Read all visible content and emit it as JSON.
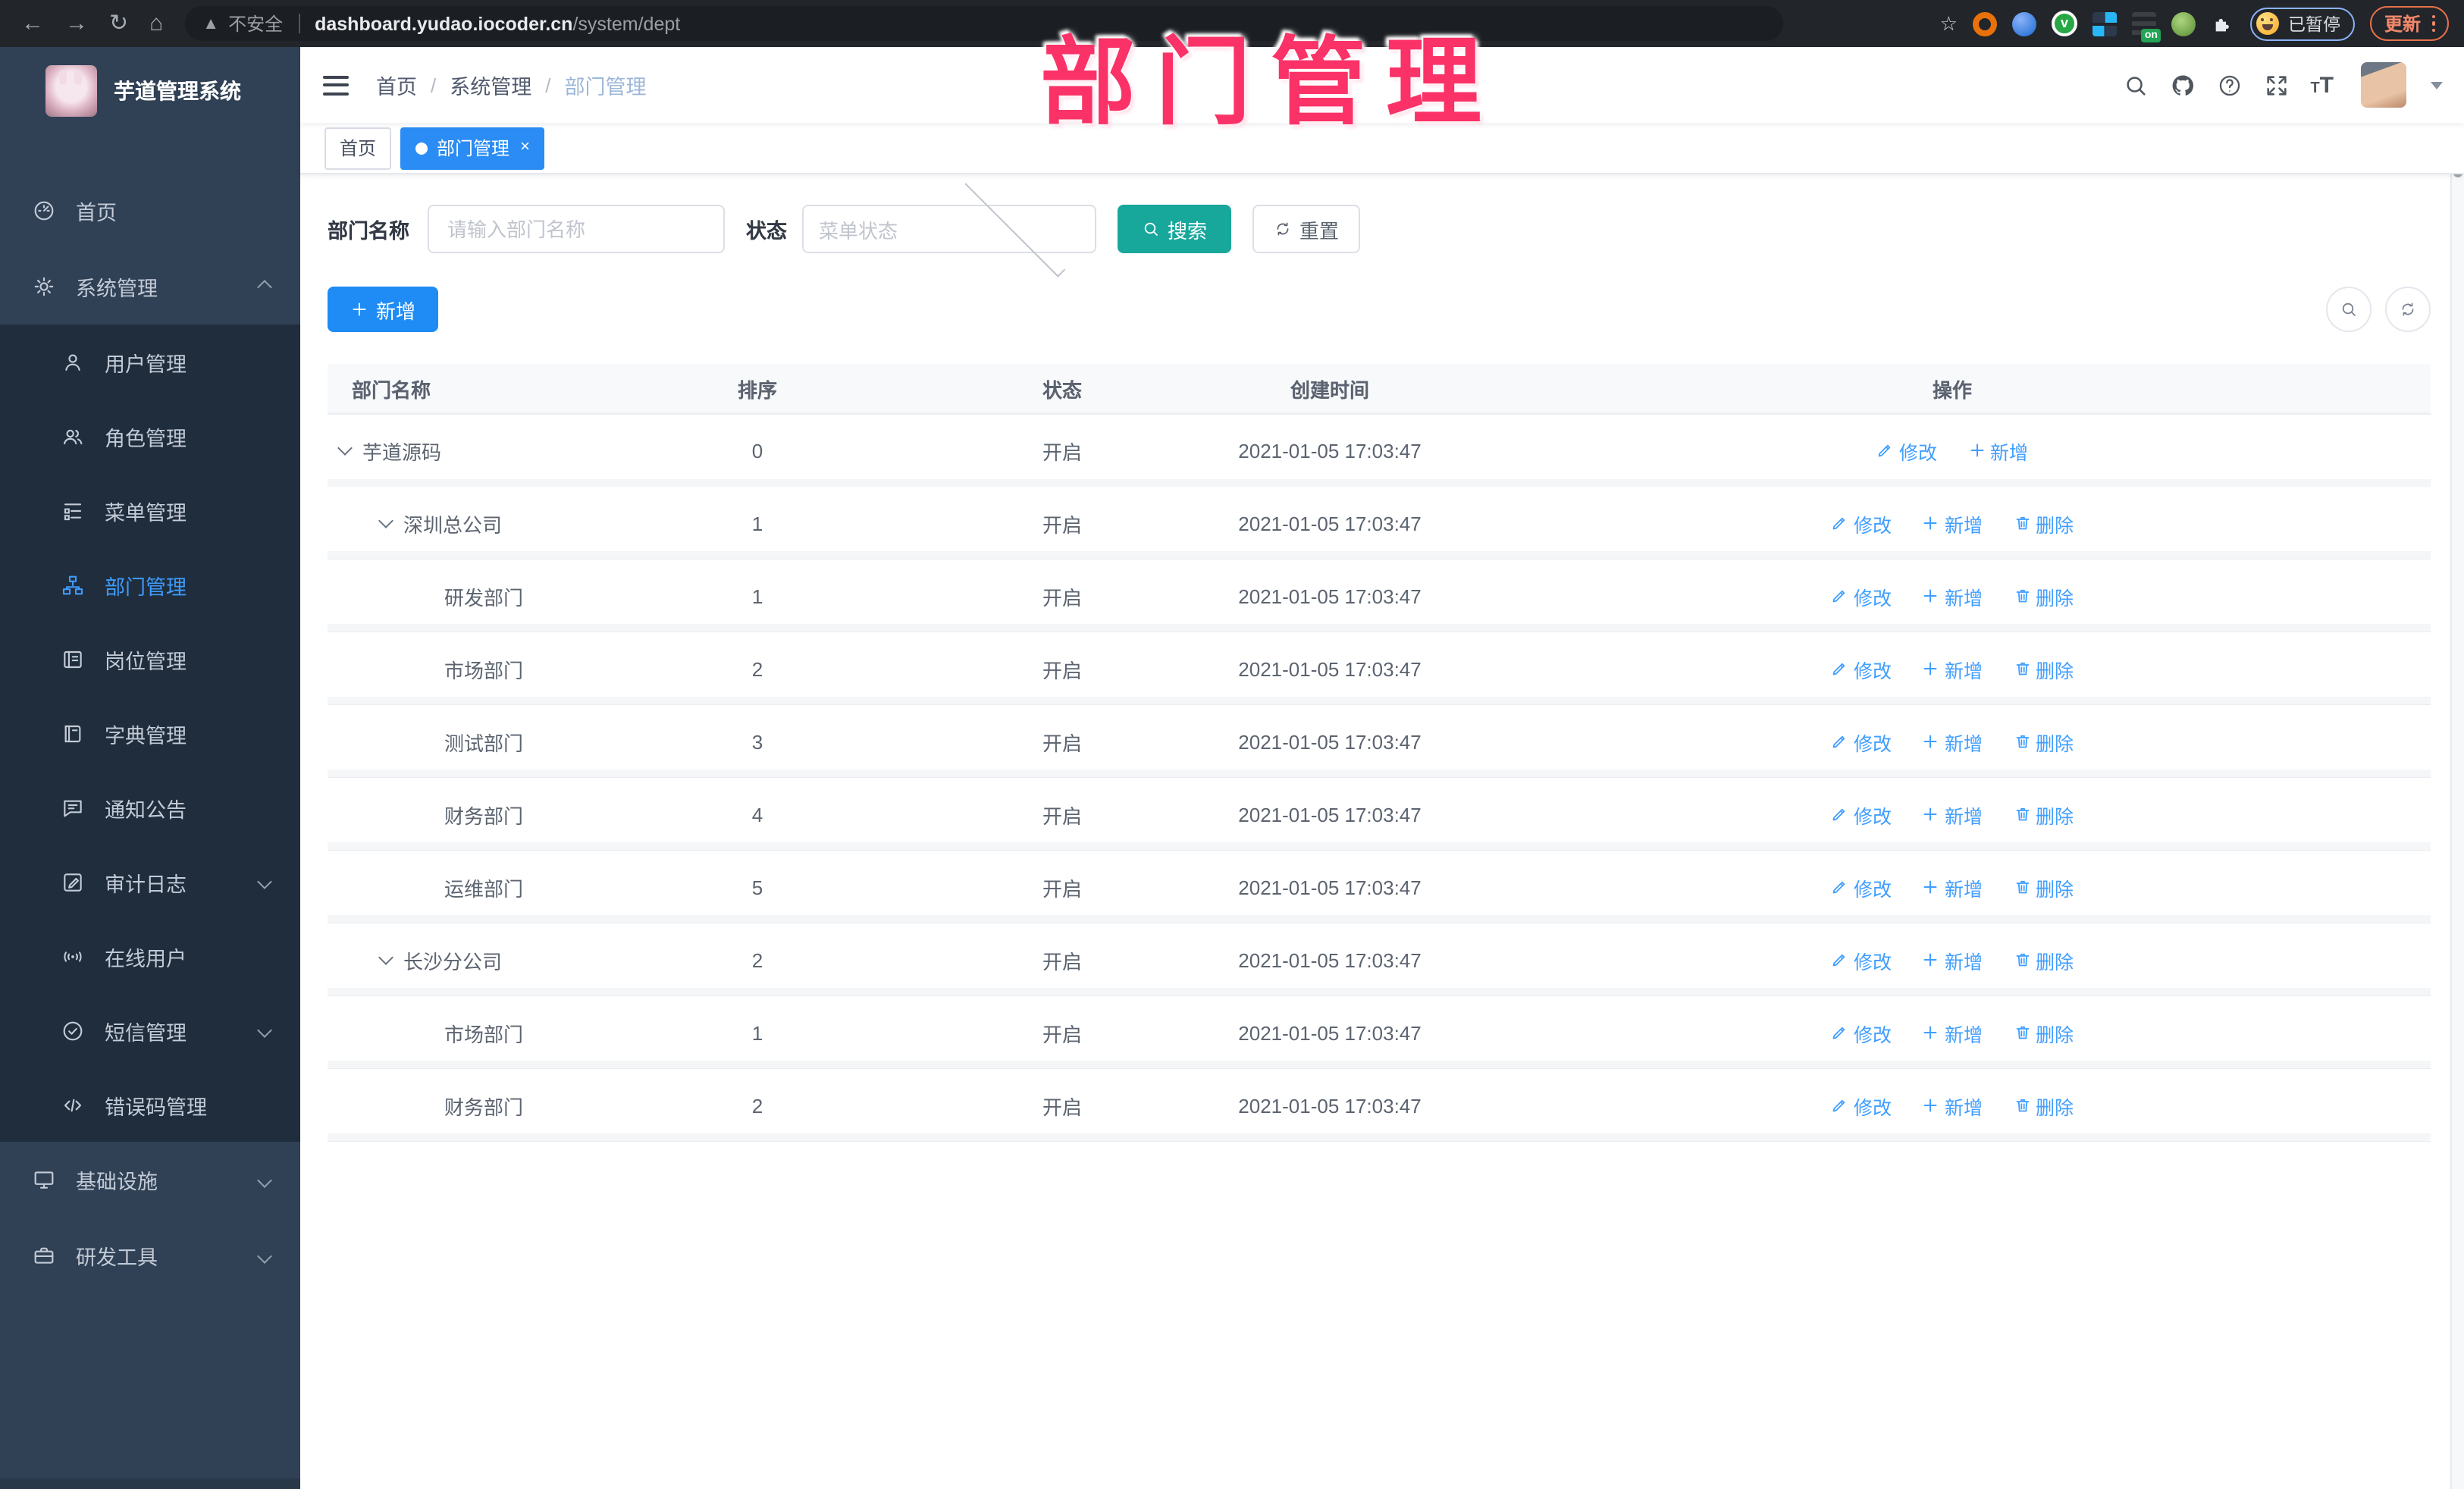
{
  "browser": {
    "security_label": "不安全",
    "url_host": "dashboard.yudao.iocoder.cn",
    "url_path": "/system/dept",
    "paused_badge": "已暂停",
    "update_label": "更新"
  },
  "watermark_text": "部门管理",
  "sidebar": {
    "title": "芋道管理系统",
    "items": [
      {
        "type": "main",
        "icon": "dashboard",
        "label": "首页"
      },
      {
        "type": "main",
        "icon": "gear",
        "label": "系统管理",
        "chevron": "up"
      },
      {
        "type": "sub",
        "icon": "user",
        "label": "用户管理"
      },
      {
        "type": "sub",
        "icon": "users",
        "label": "角色管理"
      },
      {
        "type": "sub",
        "icon": "menu-tree",
        "label": "菜单管理"
      },
      {
        "type": "sub",
        "icon": "dept",
        "label": "部门管理",
        "active": true
      },
      {
        "type": "sub",
        "icon": "post",
        "label": "岗位管理"
      },
      {
        "type": "sub",
        "icon": "dict",
        "label": "字典管理"
      },
      {
        "type": "sub",
        "icon": "notice",
        "label": "通知公告"
      },
      {
        "type": "sub",
        "icon": "audit",
        "label": "审计日志",
        "chevron": "down"
      },
      {
        "type": "sub",
        "icon": "online",
        "label": "在线用户"
      },
      {
        "type": "sub",
        "icon": "sms",
        "label": "短信管理",
        "chevron": "down"
      },
      {
        "type": "sub",
        "icon": "errcode",
        "label": "错误码管理"
      },
      {
        "type": "main",
        "icon": "infra",
        "label": "基础设施",
        "chevron": "down"
      },
      {
        "type": "main",
        "icon": "tools",
        "label": "研发工具",
        "chevron": "down"
      }
    ]
  },
  "navbar": {
    "breadcrumb": [
      "首页",
      "系统管理",
      "部门管理"
    ]
  },
  "tags": [
    {
      "label": "首页",
      "active": false,
      "closable": false
    },
    {
      "label": "部门管理",
      "active": true,
      "closable": true
    }
  ],
  "filter": {
    "name_label": "部门名称",
    "name_placeholder": "请输入部门名称",
    "status_label": "状态",
    "status_placeholder": "菜单状态",
    "search_label": "搜索",
    "reset_label": "重置"
  },
  "toolbar": {
    "add_label": "新增"
  },
  "table": {
    "headers": [
      "部门名称",
      "排序",
      "状态",
      "创建时间",
      "操作"
    ],
    "rows": [
      {
        "name": "芋道源码",
        "level": 0,
        "expandable": true,
        "sort": "0",
        "status": "开启",
        "time": "2021-01-05 17:03:47",
        "actions": [
          {
            "icon": "edit",
            "label": "修改"
          },
          {
            "icon": "plus",
            "label": "新增"
          }
        ]
      },
      {
        "name": "深圳总公司",
        "level": 1,
        "expandable": true,
        "sort": "1",
        "status": "开启",
        "time": "2021-01-05 17:03:47",
        "actions": [
          {
            "icon": "edit",
            "label": "修改"
          },
          {
            "icon": "plus",
            "label": "新增"
          },
          {
            "icon": "trash",
            "label": "删除"
          }
        ]
      },
      {
        "name": "研发部门",
        "level": 2,
        "expandable": false,
        "sort": "1",
        "status": "开启",
        "time": "2021-01-05 17:03:47",
        "actions": [
          {
            "icon": "edit",
            "label": "修改"
          },
          {
            "icon": "plus",
            "label": "新增"
          },
          {
            "icon": "trash",
            "label": "删除"
          }
        ]
      },
      {
        "name": "市场部门",
        "level": 2,
        "expandable": false,
        "sort": "2",
        "status": "开启",
        "time": "2021-01-05 17:03:47",
        "actions": [
          {
            "icon": "edit",
            "label": "修改"
          },
          {
            "icon": "plus",
            "label": "新增"
          },
          {
            "icon": "trash",
            "label": "删除"
          }
        ]
      },
      {
        "name": "测试部门",
        "level": 2,
        "expandable": false,
        "sort": "3",
        "status": "开启",
        "time": "2021-01-05 17:03:47",
        "actions": [
          {
            "icon": "edit",
            "label": "修改"
          },
          {
            "icon": "plus",
            "label": "新增"
          },
          {
            "icon": "trash",
            "label": "删除"
          }
        ]
      },
      {
        "name": "财务部门",
        "level": 2,
        "expandable": false,
        "sort": "4",
        "status": "开启",
        "time": "2021-01-05 17:03:47",
        "actions": [
          {
            "icon": "edit",
            "label": "修改"
          },
          {
            "icon": "plus",
            "label": "新增"
          },
          {
            "icon": "trash",
            "label": "删除"
          }
        ]
      },
      {
        "name": "运维部门",
        "level": 2,
        "expandable": false,
        "sort": "5",
        "status": "开启",
        "time": "2021-01-05 17:03:47",
        "actions": [
          {
            "icon": "edit",
            "label": "修改"
          },
          {
            "icon": "plus",
            "label": "新增"
          },
          {
            "icon": "trash",
            "label": "删除"
          }
        ]
      },
      {
        "name": "长沙分公司",
        "level": 1,
        "expandable": true,
        "sort": "2",
        "status": "开启",
        "time": "2021-01-05 17:03:47",
        "actions": [
          {
            "icon": "edit",
            "label": "修改"
          },
          {
            "icon": "plus",
            "label": "新增"
          },
          {
            "icon": "trash",
            "label": "删除"
          }
        ]
      },
      {
        "name": "市场部门",
        "level": 2,
        "expandable": false,
        "sort": "1",
        "status": "开启",
        "time": "2021-01-05 17:03:47",
        "actions": [
          {
            "icon": "edit",
            "label": "修改"
          },
          {
            "icon": "plus",
            "label": "新增"
          },
          {
            "icon": "trash",
            "label": "删除"
          }
        ]
      },
      {
        "name": "财务部门",
        "level": 2,
        "expandable": false,
        "sort": "2",
        "status": "开启",
        "time": "2021-01-05 17:03:47",
        "actions": [
          {
            "icon": "edit",
            "label": "修改"
          },
          {
            "icon": "plus",
            "label": "新增"
          },
          {
            "icon": "trash",
            "label": "删除"
          }
        ]
      }
    ]
  }
}
